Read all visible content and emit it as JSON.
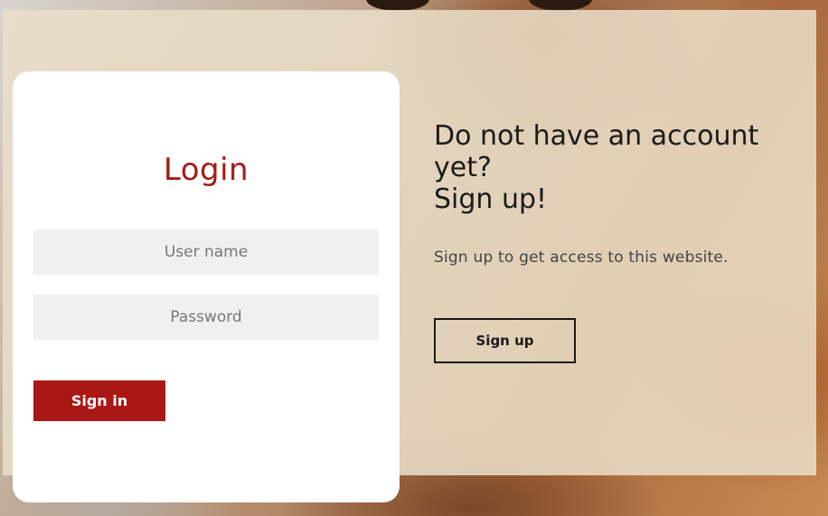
{
  "login": {
    "title": "Login",
    "username_placeholder": "User name",
    "password_placeholder": "Password",
    "signin_label": "Sign in"
  },
  "signup": {
    "heading_line1": "Do not have an account",
    "heading_line2": "yet?",
    "heading_line3": "Sign up!",
    "description": "Sign up to get access to this website.",
    "button_label": "Sign up"
  },
  "colors": {
    "accent": "#a91815",
    "title": "#a41b16",
    "input_bg": "#f0f0f0",
    "overlay": "rgba(234,222,200,0.86)"
  }
}
